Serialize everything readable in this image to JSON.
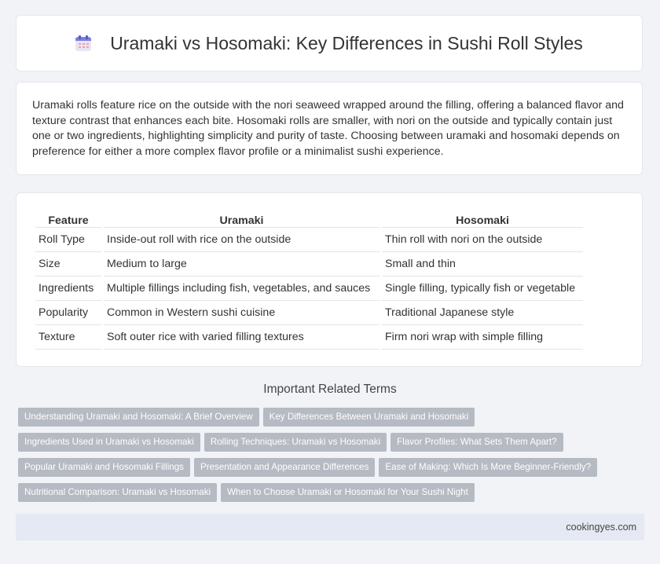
{
  "header": {
    "title": "Uramaki vs Hosomaki: Key Differences in Sushi Roll Styles",
    "icon": "calendar-icon"
  },
  "intro": {
    "text": "Uramaki rolls feature rice on the outside with the nori seaweed wrapped around the filling, offering a balanced flavor and texture contrast that enhances each bite. Hosomaki rolls are smaller, with nori on the outside and typically contain just one or two ingredients, highlighting simplicity and purity of taste. Choosing between uramaki and hosomaki depends on preference for either a more complex flavor profile or a minimalist sushi experience."
  },
  "table": {
    "headers": [
      "Feature",
      "Uramaki",
      "Hosomaki"
    ],
    "rows": [
      [
        "Roll Type",
        "Inside-out roll with rice on the outside",
        "Thin roll with nori on the outside"
      ],
      [
        "Size",
        "Medium to large",
        "Small and thin"
      ],
      [
        "Ingredients",
        "Multiple fillings including fish, vegetables, and sauces",
        "Single filling, typically fish or vegetable"
      ],
      [
        "Popularity",
        "Common in Western sushi cuisine",
        "Traditional Japanese style"
      ],
      [
        "Texture",
        "Soft outer rice with varied filling textures",
        "Firm nori wrap with simple filling"
      ]
    ]
  },
  "related": {
    "title": "Important Related Terms",
    "tags": [
      "Understanding Uramaki and Hosomaki: A Brief Overview",
      "Key Differences Between Uramaki and Hosomaki",
      "Ingredients Used in Uramaki vs Hosomaki",
      "Rolling Techniques: Uramaki vs Hosomaki",
      "Flavor Profiles: What Sets Them Apart?",
      "Popular Uramaki and Hosomaki Fillings",
      "Presentation and Appearance Differences",
      "Ease of Making: Which Is More Beginner-Friendly?",
      "Nutritional Comparison: Uramaki vs Hosomaki",
      "When to Choose Uramaki or Hosomaki for Your Sushi Night"
    ]
  },
  "footer": {
    "site": "cookingyes.com"
  }
}
